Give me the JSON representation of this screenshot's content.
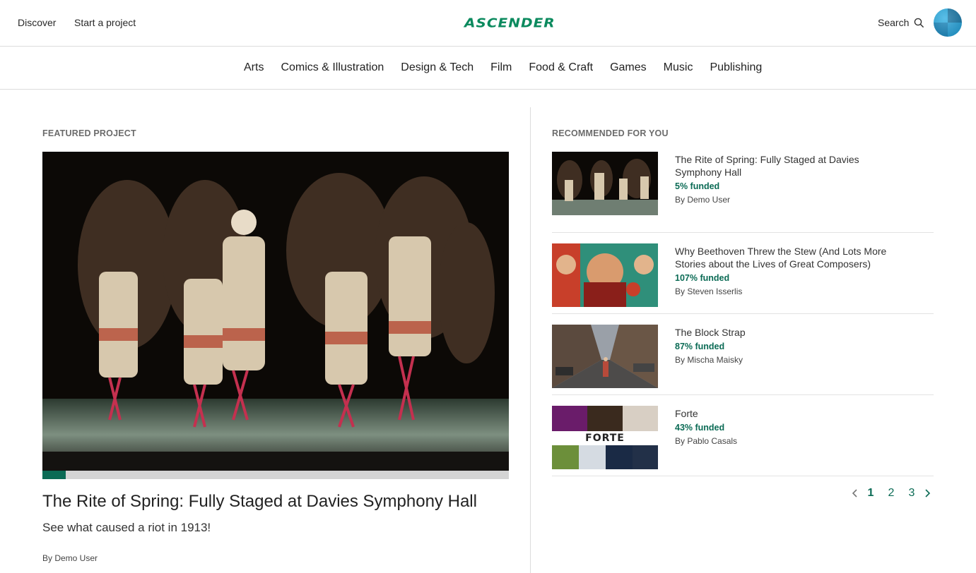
{
  "header": {
    "nav": [
      "Discover",
      "Start a project"
    ],
    "logo": "ASCENDER",
    "search_label": "Search"
  },
  "categories": [
    "Arts",
    "Comics & Illustration",
    "Design & Tech",
    "Film",
    "Food & Craft",
    "Games",
    "Music",
    "Publishing"
  ],
  "featured": {
    "section_title": "FEATURED PROJECT",
    "title": "The Rite of Spring: Fully Staged at Davies Symphony Hall",
    "blurb": "See what caused a riot in 1913!",
    "by": "By Demo User",
    "funded_fraction": 0.05
  },
  "recommended": {
    "section_title": "RECOMMENDED FOR YOU",
    "items": [
      {
        "title": "The Rite of Spring: Fully Staged at Davies Symphony Hall",
        "funded": "5% funded",
        "by": "By Demo User"
      },
      {
        "title": "Why Beethoven Threw the Stew (And Lots More Stories about the Lives of Great Composers)",
        "funded": "107% funded",
        "by": "By Steven Isserlis"
      },
      {
        "title": "The Block Strap",
        "funded": "87% funded",
        "by": "By Mischa Maisky"
      },
      {
        "title": "Forte",
        "funded": "43% funded",
        "by": "By Pablo Casals",
        "thumb_text": "FORTE"
      }
    ]
  },
  "pagination": {
    "pages": [
      "1",
      "2",
      "3"
    ],
    "current": "1"
  },
  "colors": {
    "accent": "#0b6b55",
    "logo": "#0b8a5e"
  }
}
